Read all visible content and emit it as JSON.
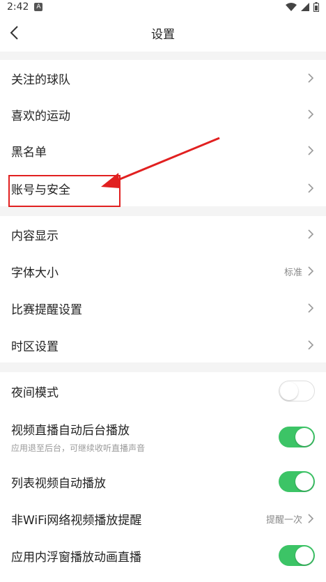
{
  "status": {
    "time": "2:42",
    "badge": "A"
  },
  "header": {
    "title": "设置"
  },
  "groups": [
    {
      "items": [
        {
          "label": "关注的球队"
        },
        {
          "label": "喜欢的运动"
        },
        {
          "label": "黑名单"
        },
        {
          "label": "账号与安全"
        }
      ]
    },
    {
      "items": [
        {
          "label": "内容显示"
        },
        {
          "label": "字体大小",
          "value": "标准"
        },
        {
          "label": "比赛提醒设置"
        },
        {
          "label": "时区设置"
        }
      ]
    },
    {
      "items": [
        {
          "label": "夜间模式",
          "toggle": "off"
        },
        {
          "label": "视频直播自动后台播放",
          "subtext": "应用退至后台，可继续收听直播声音",
          "toggle": "on"
        },
        {
          "label": "列表视频自动播放",
          "toggle": "on"
        },
        {
          "label": "非WiFi网络视频播放提醒",
          "value": "提醒一次"
        },
        {
          "label": "应用内浮窗播放动画直播",
          "toggle": "on"
        }
      ]
    }
  ],
  "colors": {
    "toggle_on": "#3cc466",
    "annotation": "#e12020"
  }
}
